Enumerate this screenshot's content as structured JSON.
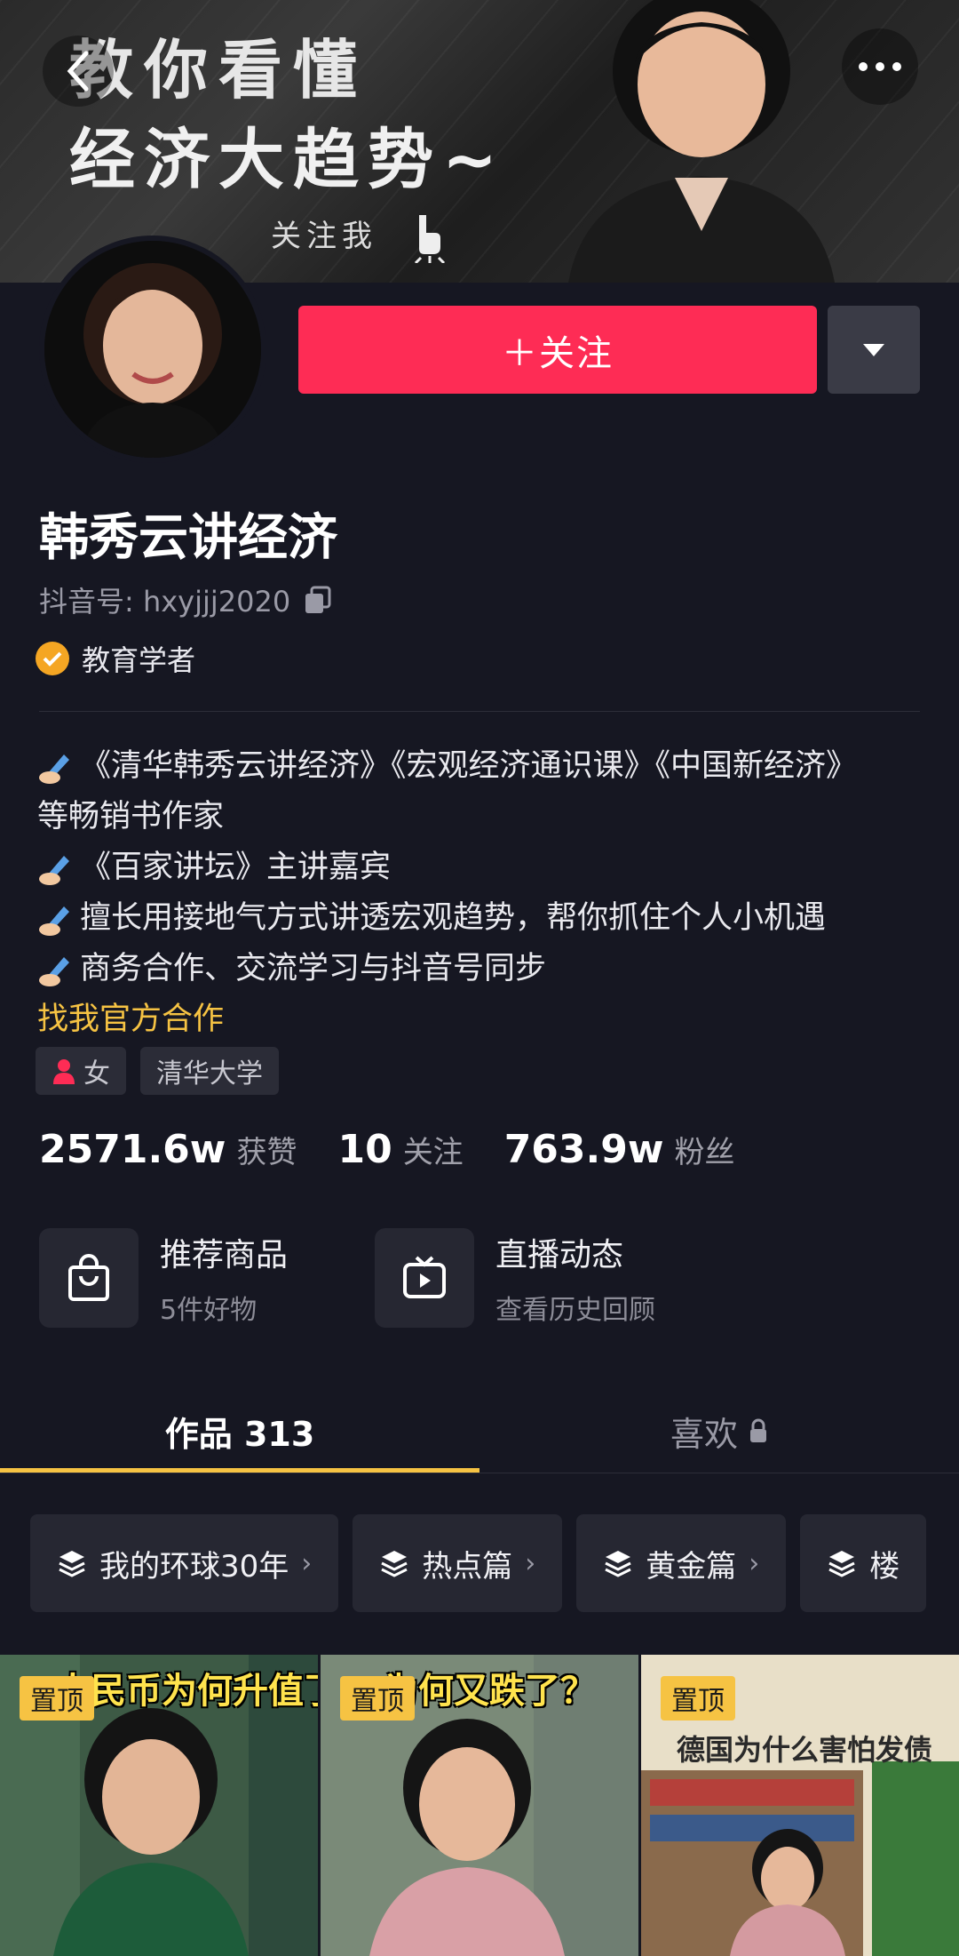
{
  "banner": {
    "line1": "教你看懂",
    "line2": "经济大趋势~",
    "line3": "关注我"
  },
  "header": {
    "back_icon": "chevron-left-icon",
    "more_icon": "more-dots-icon"
  },
  "actions": {
    "follow_label": "＋关注",
    "dropdown_icon": "caret-down-icon",
    "follow_color": "#fe2c55"
  },
  "profile": {
    "name": "韩秀云讲经济",
    "douyin_id": "抖音号: hxyjjj2020",
    "verify_label": "教育学者",
    "verify_color": "#f5a623"
  },
  "bio": {
    "lines": [
      "《清华韩秀云讲经济》《宏观经济通识课》《中国新经济》",
      "等畅销书作家",
      "《百家讲坛》主讲嘉宾",
      "擅长用接地气方式讲透宏观趋势，帮你抓住个人小机遇",
      "商务合作、交流学习与抖音号同步"
    ],
    "cooperation_link": "找我官方合作"
  },
  "tags": [
    {
      "label": "女"
    },
    {
      "label": "清华大学"
    }
  ],
  "stats": [
    {
      "value": "2571.6w",
      "label": "获赞"
    },
    {
      "value": "10",
      "label": "关注"
    },
    {
      "value": "763.9w",
      "label": "粉丝"
    }
  ],
  "cards": [
    {
      "title": "推荐商品",
      "subtitle": "5件好物",
      "icon": "shopping-bag-icon"
    },
    {
      "title": "直播动态",
      "subtitle": "查看历史回顾",
      "icon": "tv-play-icon"
    }
  ],
  "tabs": {
    "works": "作品 313",
    "likes": "喜欢"
  },
  "collections": [
    {
      "label": "我的环球30年"
    },
    {
      "label": "热点篇"
    },
    {
      "label": "黄金篇"
    },
    {
      "label": "楼"
    }
  ],
  "videos": [
    {
      "pin": "置顶",
      "caption": "人民币为何升值了？"
    },
    {
      "pin": "置顶",
      "caption": "为何又跌了？"
    },
    {
      "pin": "置顶",
      "caption": "德国为什么害怕发债"
    }
  ]
}
